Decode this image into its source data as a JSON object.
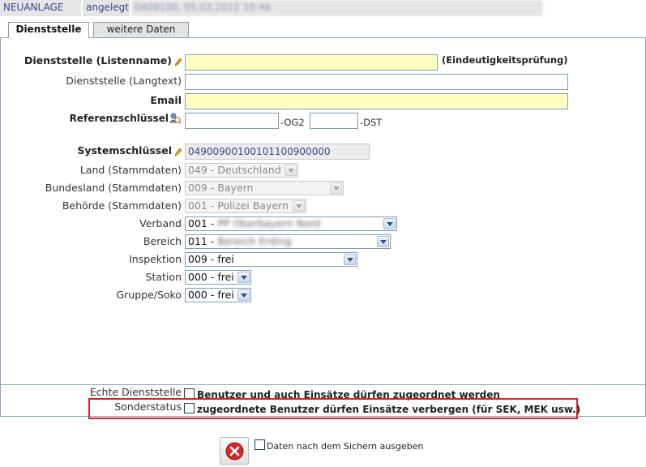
{
  "status": {
    "record_state": "NEUANLAGE",
    "state_value": "angelegt",
    "info_redacted": "0409100, 05.03.2012 10:46"
  },
  "tabs": [
    {
      "label": "Dienststelle",
      "active": true
    },
    {
      "label": "weitere Daten",
      "active": false
    }
  ],
  "form": {
    "listenname_label": "Dienststelle (Listenname)",
    "listenname_value": "",
    "uniqueness_hint": "(Eindeutigkeitsprüfung)",
    "langtext_label": "Dienststelle (Langtext)",
    "langtext_value": "",
    "email_label": "Email",
    "email_value": "",
    "ref_label": "Referenzschlüssel",
    "ref_og2_value": "",
    "ref_og2_suffix": "-OG2",
    "ref_dst_value": "",
    "ref_dst_suffix": "-DST",
    "systemkey_label": "Systemschlüssel",
    "systemkey_value": "04900900100101100900000",
    "land_label": "Land (Stammdaten)",
    "land_value": "049 - Deutschland",
    "bundesland_label": "Bundesland (Stammdaten)",
    "bundesland_value": "009 - Bayern",
    "behoerde_label": "Behörde (Stammdaten)",
    "behoerde_value": "001 - Polizei Bayern",
    "verband_label": "Verband",
    "verband_prefix": "001 -",
    "verband_redacted": "PP Oberbayern Nord",
    "bereich_label": "Bereich",
    "bereich_prefix": "011 -",
    "bereich_redacted": "Bereich Erding",
    "inspektion_label": "Inspektion",
    "inspektion_value": "009 - frei",
    "station_label": "Station",
    "station_value": "000 - frei",
    "gruppe_label": "Gruppe/Soko",
    "gruppe_value": "000 - frei"
  },
  "flags": {
    "echte_label": "Echte Dienststelle",
    "echte_text": "Benutzer und auch Einsätze dürfen zugeordnet werden",
    "sonder_label": "Sonderstatus",
    "sonder_text": "zugeordnete Benutzer dürfen Einsätze verbergen (für SEK, MEK usw.)"
  },
  "footer": {
    "print_after_save_label": "Daten nach dem Sichern ausgeben"
  },
  "colors": {
    "required_field": "#ffffc0",
    "panel_border": "#86a3c7",
    "highlight_border": "#e01e24",
    "cancel_red": "#d12a2a"
  },
  "icons": {
    "edit": "pencil-icon",
    "lookup": "search-user-icon",
    "dropdown": "chevron-down-icon",
    "cancel": "close-circle-icon"
  }
}
